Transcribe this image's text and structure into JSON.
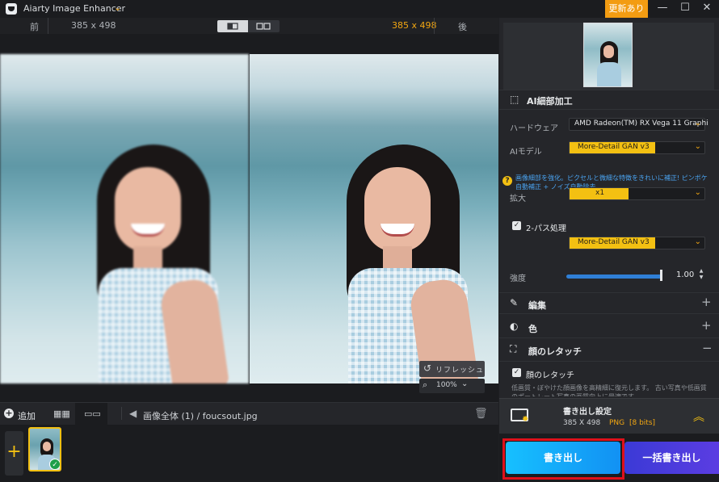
{
  "app": {
    "title": "Aiarty Image Enhancer",
    "update_badge": "更新あり"
  },
  "window": {
    "minimize": "—",
    "maximize": "☐",
    "close": "✕"
  },
  "compare": {
    "before_label": "前",
    "after_label": "後",
    "size_left": "385 x 498",
    "size_right": "385 x 498"
  },
  "preview": {
    "refresh_label": "リフレッシュ",
    "zoom": "100%"
  },
  "toolbar": {
    "add_label": "追加",
    "breadcrumb": "画像全体 (1)  /  foucsout.jpg"
  },
  "panel": {
    "ai_detail": {
      "title": "AI細部加工",
      "hardware_label": "ハードウェア",
      "hardware_value": "AMD Radeon(TM) RX Vega 11 Graphi",
      "model_label": "AIモデル",
      "model_value": "More-Detail GAN  v3",
      "hint": "画像細部を強化。ピクセルと微細な特徴をきれいに補正! ピンボケ自動補正 + ノイズ自動除去。",
      "scale_label": "拡大",
      "scale_value": "x1",
      "two_pass_label": "2-パス処理",
      "two_pass_model": "More-Detail GAN  v3",
      "strength_label": "強度",
      "strength_value": "1.00",
      "strength_level": 1.0
    },
    "edit_title": "編集",
    "color_title": "色",
    "face": {
      "title": "顔のレタッチ",
      "checkbox_label": "顔のレタッチ",
      "desc": "低画質・ぼやけた顔画像を高精細に復元します。 古い写真や低画質のポートレート写真の画質向上に最適です。"
    }
  },
  "export": {
    "title": "書き出し設定",
    "size": "385 X 498",
    "format": "PNG",
    "bits": "[8 bits]",
    "export_button": "書き出し",
    "batch_button": "一括書き出し"
  },
  "colors": {
    "accent": "#f3c012",
    "export_blue": "#16c0ff",
    "batch_purple": "#4b3bdc",
    "highlight_red": "#e0101a"
  }
}
